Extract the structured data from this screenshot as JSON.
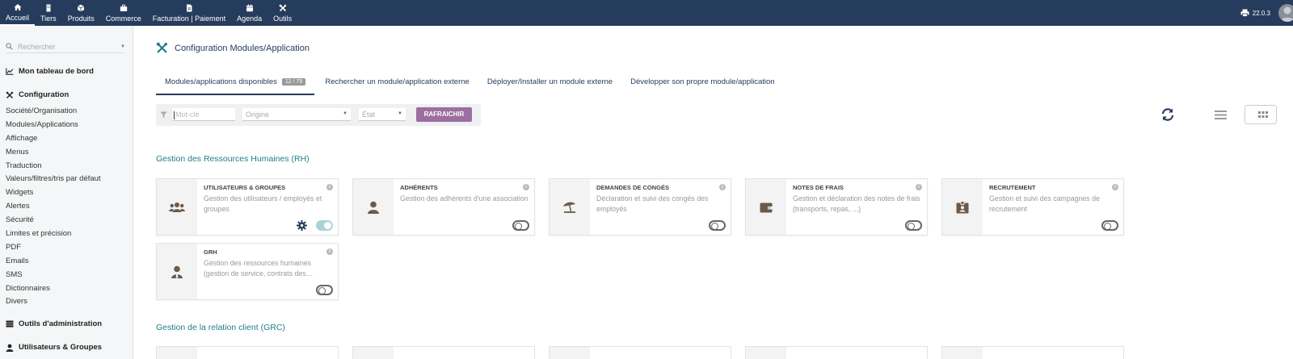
{
  "topnav": {
    "items": [
      {
        "label": "Accueil",
        "icon": "home-icon"
      },
      {
        "label": "Tiers",
        "icon": "building-icon"
      },
      {
        "label": "Produits",
        "icon": "cube-icon"
      },
      {
        "label": "Commerce",
        "icon": "briefcase-icon"
      },
      {
        "label": "Facturation | Paiement",
        "icon": "invoice-icon"
      },
      {
        "label": "Agenda",
        "icon": "calendar-icon"
      },
      {
        "label": "Outils",
        "icon": "tools-icon"
      }
    ],
    "version": "22.0.3"
  },
  "sidebar": {
    "search_placeholder": "Rechercher",
    "dashboard": "Mon tableau de bord",
    "configuration": "Configuration",
    "links": [
      "Société/Organisation",
      "Modules/Applications",
      "Affichage",
      "Menus",
      "Traduction",
      "Valeurs/filtres/tris par défaut",
      "Widgets",
      "Alertes",
      "Sécurité",
      "Limites et précision",
      "PDF",
      "Emails",
      "SMS",
      "Dictionnaires",
      "Divers"
    ],
    "admin_tools": "Outils d'administration",
    "users_groups": "Utilisateurs & Groupes"
  },
  "main": {
    "title": "Configuration Modules/Application",
    "tabs": [
      {
        "label": "Modules/applications disponibles",
        "badge": "12 / 79"
      },
      {
        "label": "Rechercher un module/application externe"
      },
      {
        "label": "Déployer/Installer un module externe"
      },
      {
        "label": "Développer son propre module/application"
      }
    ],
    "filters": {
      "keyword_placeholder": "Mot-clé",
      "origin_placeholder": "Origine",
      "state_placeholder": "État",
      "refresh_label": "RAFRAICHIR"
    },
    "sections": [
      {
        "title": "Gestion des Ressources Humaines (RH)",
        "cards": [
          {
            "title": "UTILISATEURS & GROUPES",
            "desc": "Gestion des utilisateurs / employés et groupes",
            "icon": "users-icon",
            "enabled": true,
            "has_settings": true
          },
          {
            "title": "ADHÉRENTS",
            "desc": "Gestion des adhérents d'une association",
            "icon": "user-icon",
            "enabled": false
          },
          {
            "title": "DEMANDES DE CONGÉS",
            "desc": "Déclaration et suivi des congés des employés",
            "icon": "beach-umbrella-icon",
            "enabled": false
          },
          {
            "title": "NOTES DE FRAIS",
            "desc": "Gestion et déclaration des notes de frais (transports, repas, ...)",
            "icon": "wallet-icon",
            "enabled": false
          },
          {
            "title": "RECRUTEMENT",
            "desc": "Gestion et suivi des campagnes de recrutement",
            "icon": "id-badge-icon",
            "enabled": false
          },
          {
            "title": "GRH",
            "desc": "Gestion des ressources humaines (gestion de service, contrats des…",
            "icon": "user-tie-icon",
            "enabled": false
          }
        ]
      },
      {
        "title": "Gestion de la relation client (GRC)"
      }
    ]
  }
}
